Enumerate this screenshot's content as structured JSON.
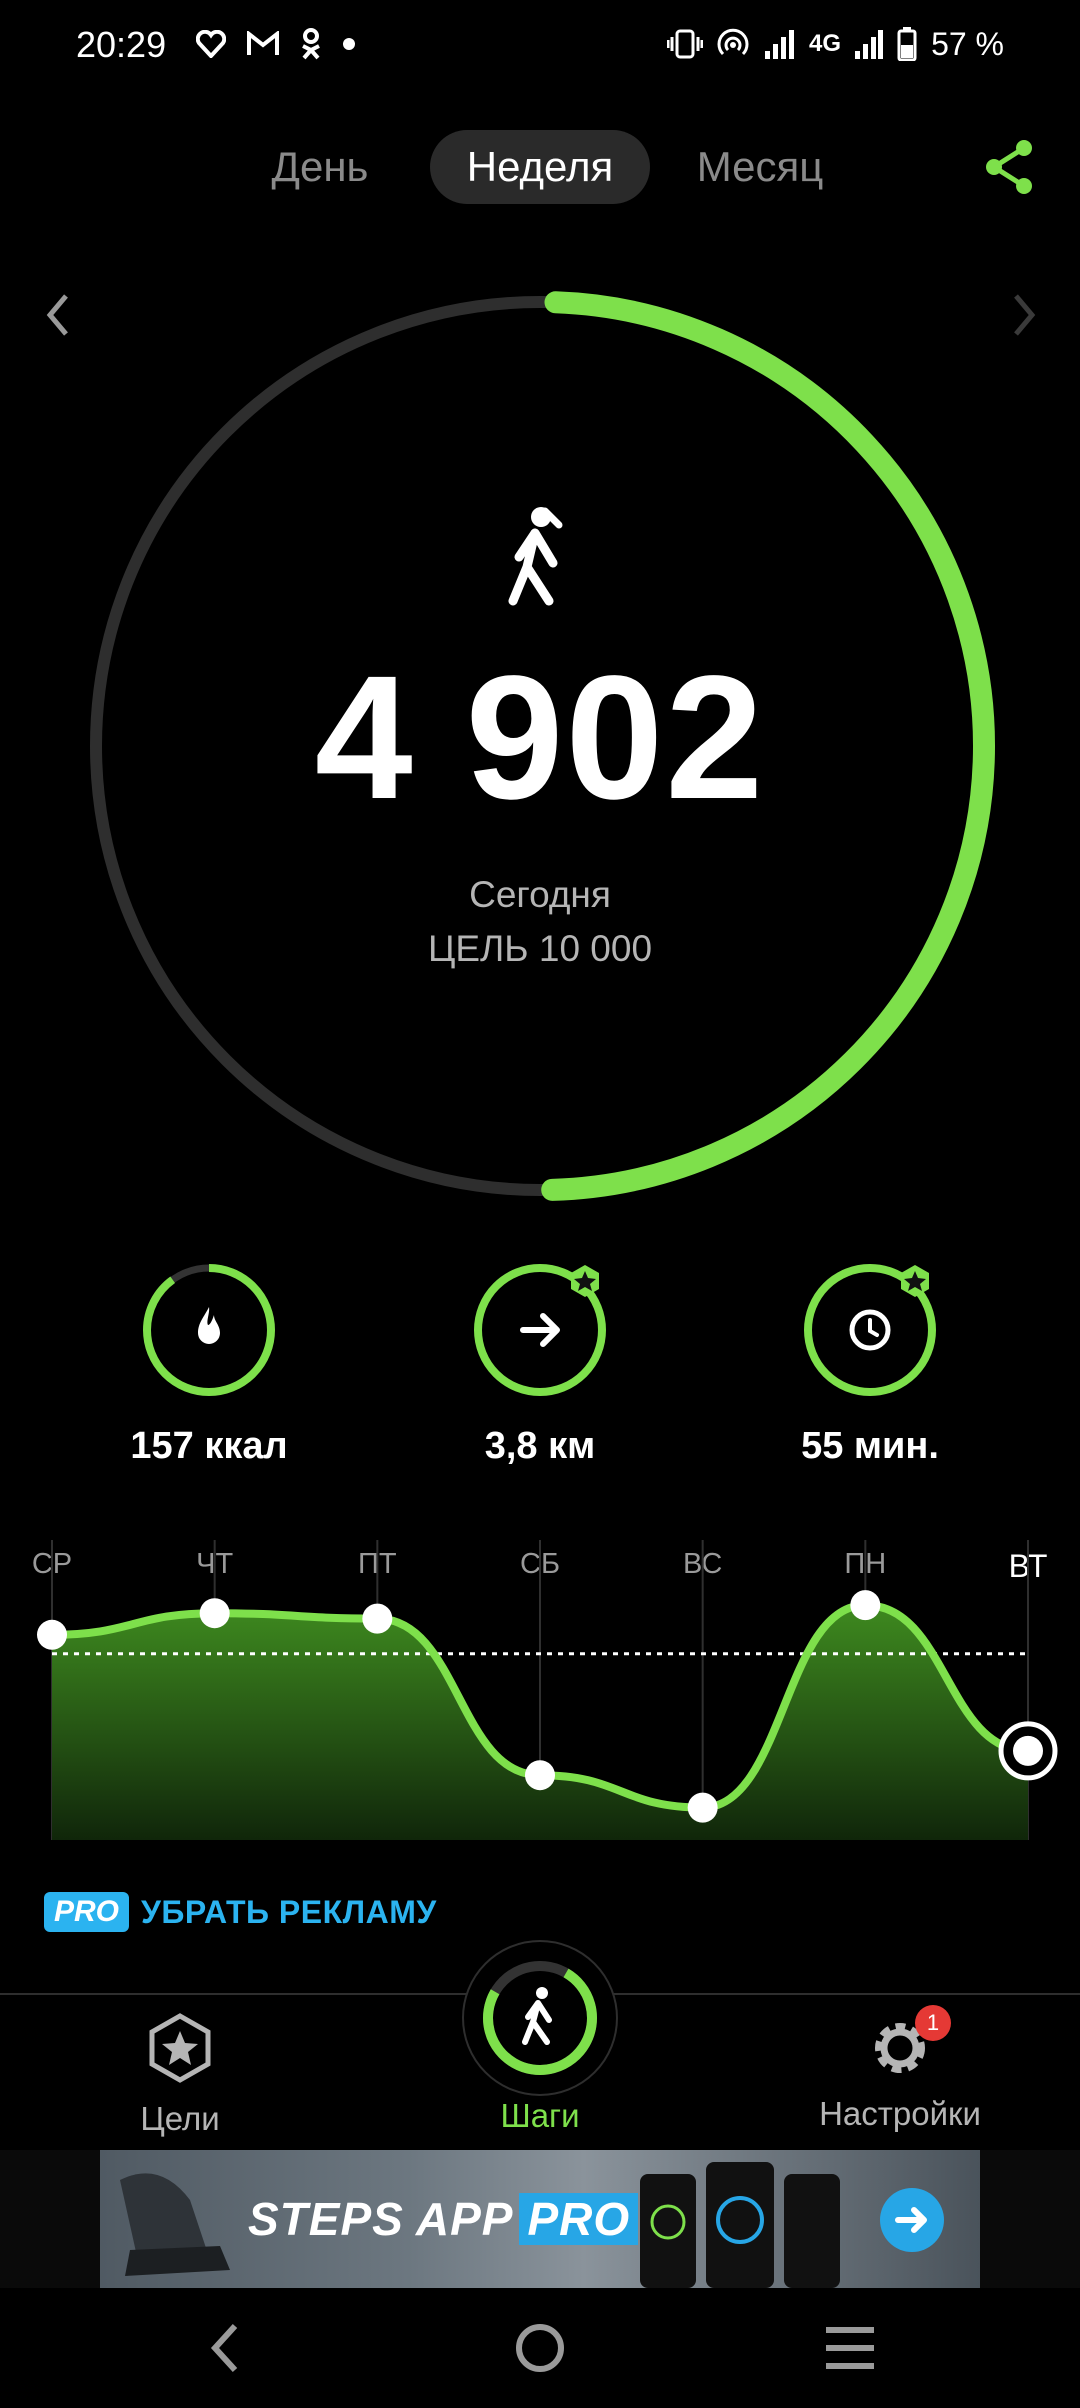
{
  "status_bar": {
    "time": "20:29",
    "left_icons": [
      "heart-icon",
      "gmail-icon",
      "ok-icon",
      "dot-icon"
    ],
    "right_icons": [
      "vibrate-icon",
      "hotspot-icon",
      "signal-icon",
      "signal-4g-icon",
      "battery-icon"
    ],
    "network": "4G",
    "battery": "57 %"
  },
  "period_tabs": {
    "items": [
      {
        "label": "День"
      },
      {
        "label": "Неделя"
      },
      {
        "label": "Месяц"
      }
    ],
    "active_index": 1
  },
  "summary": {
    "steps": "4 902",
    "period_label": "Сегодня",
    "goal_label": "ЦЕЛЬ 10 000",
    "progress": 0.49
  },
  "metrics": [
    {
      "name": "calories",
      "icon": "flame-icon",
      "value": "157 ккал",
      "progress": 0.9,
      "starred": false
    },
    {
      "name": "distance",
      "icon": "arrow-right-icon",
      "value": "3,8 км",
      "progress": 1.0,
      "starred": true
    },
    {
      "name": "time",
      "icon": "clock-icon",
      "value": "55 мин.",
      "progress": 1.0,
      "starred": true
    }
  ],
  "chart_data": {
    "type": "area",
    "categories": [
      "СР",
      "ЧТ",
      "ПТ",
      "СБ",
      "ВС",
      "ПН",
      "ВТ"
    ],
    "values": [
      0.76,
      0.84,
      0.82,
      0.24,
      0.12,
      0.87,
      0.33
    ],
    "goal_line": 0.69,
    "today_index": 6,
    "xlabel": "",
    "ylabel": ""
  },
  "pro": {
    "badge": "PRO",
    "text": "УБРАТЬ РЕКЛАМУ"
  },
  "bottom_nav": {
    "items": [
      {
        "label": "Цели",
        "icon": "star-badge-icon"
      },
      {
        "label": "Шаги",
        "icon": "walker-icon"
      },
      {
        "label": "Настройки",
        "icon": "gear-icon"
      }
    ],
    "active_index": 1,
    "settings_badge": "1"
  },
  "ad": {
    "title_main": "STEPS APP",
    "title_pro": "PRO"
  },
  "colors": {
    "accent": "#7ee04b",
    "ring_track": "#2e2e2e",
    "pro_blue": "#2bb3f0"
  }
}
